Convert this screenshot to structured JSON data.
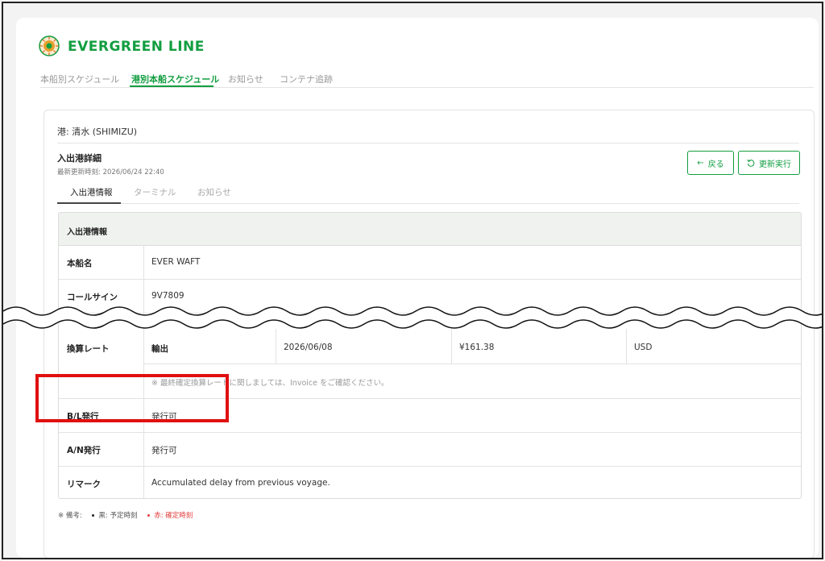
{
  "brand": {
    "name": "EVERGREEN LINE",
    "color": "#129e40",
    "logo_icon": "evergreen-logo-icon"
  },
  "nav": {
    "tabs": [
      {
        "label": "本船別スケジュール",
        "active": false
      },
      {
        "label": "港別本船スケジュール",
        "active": true
      },
      {
        "label": "お知らせ",
        "active": false
      },
      {
        "label": "コンテナ追跡",
        "active": false
      }
    ]
  },
  "port": {
    "label": "港: 清水 (SHIMIZU)"
  },
  "detail": {
    "title": "入出港詳細",
    "updated": "最新更新時刻: 2026/06/24 22:40",
    "back_label": "戻る",
    "refresh_label": "更新実行"
  },
  "sub_tabs": [
    {
      "label": "入出港情報",
      "active": true
    },
    {
      "label": "ターミナル",
      "active": false
    },
    {
      "label": "お知らせ",
      "active": false
    }
  ],
  "table": {
    "header": "入出港情報",
    "rows": [
      {
        "label": "本船名",
        "value": "EVER WAFT"
      },
      {
        "label": "コールサイン",
        "value": "9V7809"
      },
      {
        "label": "換算レート",
        "cells": [
          "輸出",
          "2026/06/08",
          "¥161.38",
          "USD"
        ],
        "note": "※ 最終確定換算レートに関しましては、Invoice をご確認ください。"
      },
      {
        "label": "B/L発行",
        "value": "発行可"
      },
      {
        "label": "A/N発行",
        "value": "発行可"
      },
      {
        "label": "リマーク",
        "value": "Accumulated delay from previous voyage."
      }
    ]
  },
  "legend": {
    "prefix": "※ 備考:",
    "black": "黒: 予定時刻",
    "red": "赤: 確定時刻",
    "black_color": "#222222",
    "red_color": "#e23b3b"
  },
  "annotation": {
    "highlight_color": "#e01010"
  }
}
